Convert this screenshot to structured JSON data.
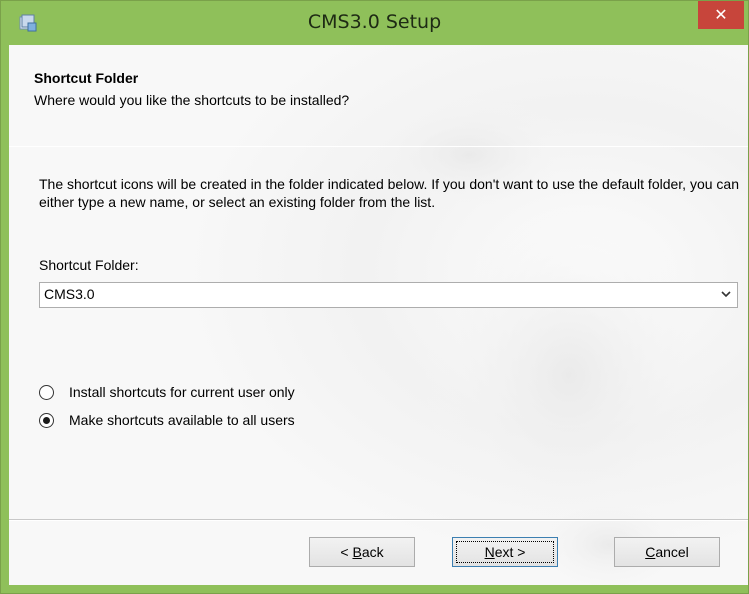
{
  "window": {
    "title": "CMS3.0 Setup",
    "close_label": "✕"
  },
  "header": {
    "title": "Shortcut Folder",
    "subtitle": "Where would you like the shortcuts to be installed?"
  },
  "main": {
    "description": "The shortcut icons will be created in the folder indicated below. If you don't want to use the default folder, you can either type a new name, or select an existing folder from the list.",
    "field_label": "Shortcut Folder:",
    "folder_value": "CMS3.0",
    "radios": [
      {
        "label": "Install shortcuts for current user only",
        "checked": false
      },
      {
        "label": "Make shortcuts available to all users",
        "checked": true
      }
    ]
  },
  "buttons": {
    "back_prefix": "< ",
    "back_access": "B",
    "back_rest": "ack",
    "next_access": "N",
    "next_rest": "ext >",
    "cancel_access": "C",
    "cancel_rest": "ancel"
  },
  "colors": {
    "titlebar": "#8fc05a",
    "close": "#c7453b",
    "client": "#f7f7f7"
  },
  "icons": {
    "app": "setup-icon",
    "dropdown": "chevron-down-icon",
    "close": "close-icon"
  }
}
